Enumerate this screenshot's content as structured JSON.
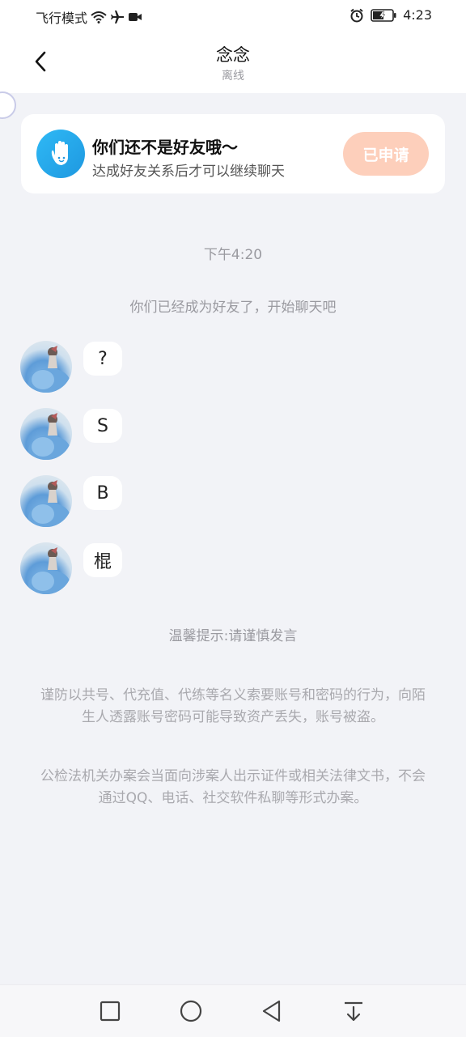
{
  "status_bar": {
    "left_text": "飞行模式",
    "time": "4:23",
    "icons": [
      "wifi-icon",
      "airplane-icon",
      "camera-icon",
      "alarm-icon",
      "battery-icon"
    ]
  },
  "header": {
    "title": "念念",
    "subtitle": "离线",
    "back_icon": "chevron-left-icon"
  },
  "friend_card": {
    "title": "你们还不是好友哦～",
    "description": "达成好友关系后才可以继续聊天",
    "button_label": "已申请",
    "button_color": "#fdcfbb"
  },
  "chat": {
    "time_label": "下午4:20",
    "system_message": "你们已经成为好友了，开始聊天吧",
    "messages": [
      {
        "text": "?"
      },
      {
        "text": "S"
      },
      {
        "text": "B"
      },
      {
        "text": "棍"
      }
    ]
  },
  "tips": {
    "title": "温馨提示:请谨慎发言",
    "notice1": "谨防以共号、代充值、代练等名义索要账号和密码的行为，向陌生人透露账号密码可能导致资产丢失，账号被盗。",
    "notice2": "公检法机关办案会当面向涉案人出示证件或相关法律文书，不会通过QQ、电话、社交软件私聊等形式办案。"
  },
  "nav_bar": {
    "buttons": [
      "recent-apps-icon",
      "home-icon",
      "back-icon",
      "pull-down-icon"
    ]
  }
}
